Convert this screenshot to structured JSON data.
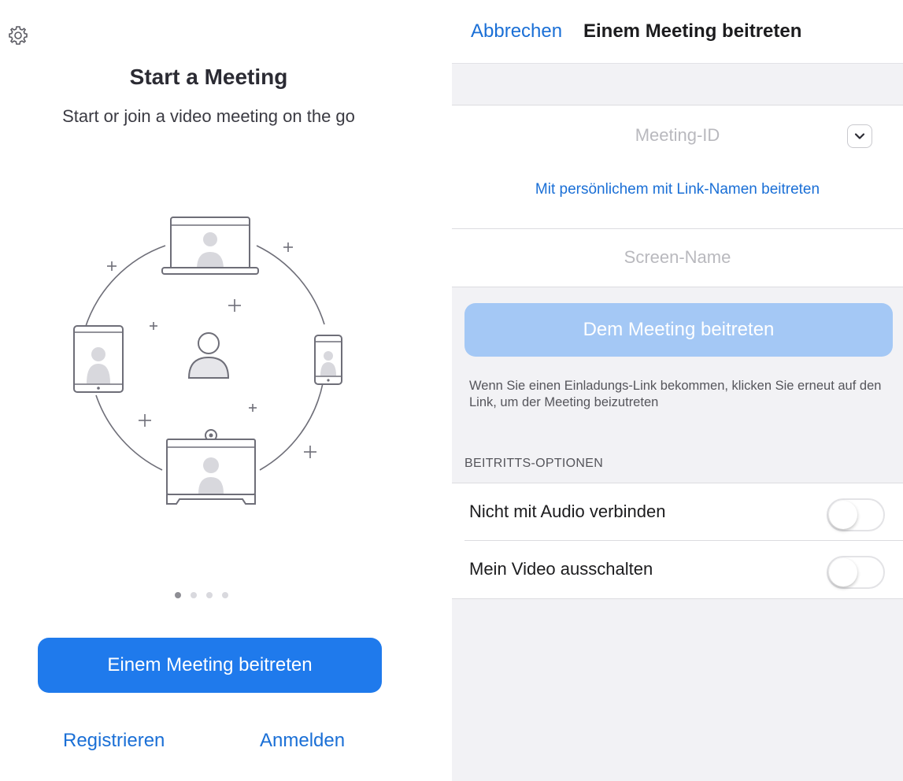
{
  "left_screen": {
    "icons": {
      "settings": "gear-icon"
    },
    "title": "Start a Meeting",
    "subtitle": "Start or join a video meeting on the go",
    "illustration": "video-meeting-devices-illustration",
    "pagination": {
      "count": 4,
      "active_index": 0
    },
    "join_button": "Einem Meeting beitreten",
    "register_link": "Registrieren",
    "signin_link": "Anmelden"
  },
  "right_screen": {
    "header": {
      "cancel": "Abbrechen",
      "title": "Einem Meeting beitreten"
    },
    "meeting_id": {
      "placeholder": "Meeting-ID",
      "value": ""
    },
    "dropdown_icon": "chevron-down-icon",
    "personal_link": "Mit persönlichem mit Link-Namen beitreten",
    "screen_name": {
      "placeholder": "Screen-Name",
      "value": ""
    },
    "join_button": "Dem Meeting beitreten",
    "hint": "Wenn Sie einen Einladungs-Link bekommen, klicken Sie erneut auf den Link, um der Meeting beizutreten",
    "section_header": "BEITRITTS-OPTIONEN",
    "options": [
      {
        "label": "Nicht mit Audio verbinden",
        "enabled": false
      },
      {
        "label": "Mein Video ausschalten",
        "enabled": false
      }
    ]
  },
  "colors": {
    "accent": "#1f7aec",
    "accent_disabled": "#a4c8f5",
    "link": "#1a6fd6",
    "background_grouped": "#f2f2f5"
  }
}
